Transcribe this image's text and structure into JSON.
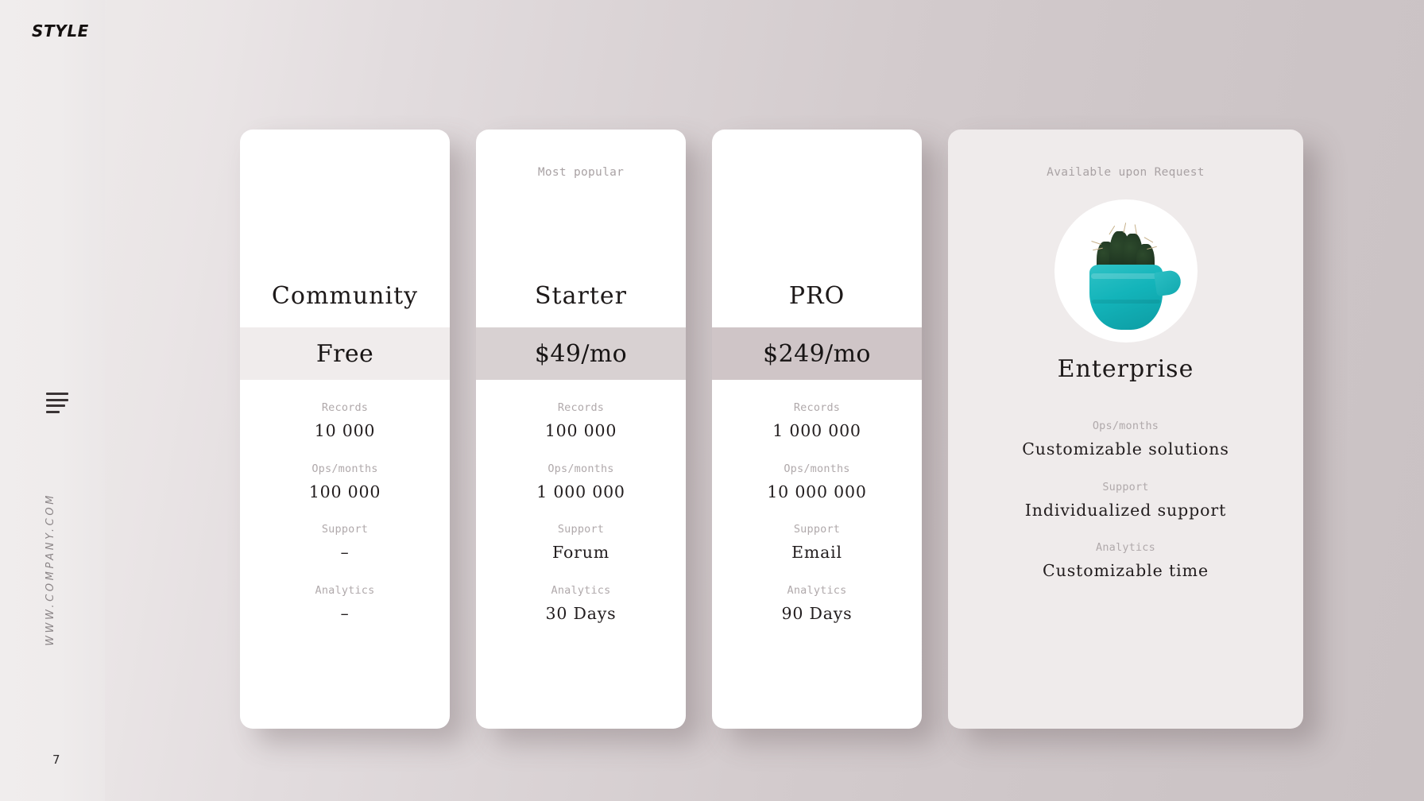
{
  "brand": {
    "logo": "STYLE",
    "url": "WWW.COMPANY.COM",
    "page_number": "7"
  },
  "icons": {
    "menu": "hamburger-menu-icon"
  },
  "colors": {
    "background_left": "#efecec",
    "background_right": "#cac2c4",
    "card_bg": "#ffffff",
    "enterprise_card_bg": "#efebeb",
    "price_band_1": "#f0ecec",
    "price_band_2": "#d8d1d2",
    "price_band_3": "#cfc5c7",
    "label_grey": "#b0a9ab",
    "accent_teal": "#13b4ba",
    "cactus_green": "#1d3320"
  },
  "feature_labels": {
    "records": "Records",
    "ops": "Ops/months",
    "support": "Support",
    "analytics": "Analytics"
  },
  "plans": [
    {
      "badge": "",
      "name": "Community",
      "price": "Free",
      "features": [
        {
          "label": "Records",
          "value": "10 000"
        },
        {
          "label": "Ops/months",
          "value": "100 000"
        },
        {
          "label": "Support",
          "value": "–"
        },
        {
          "label": "Analytics",
          "value": "–"
        }
      ]
    },
    {
      "badge": "Most popular",
      "name": "Starter",
      "price": "$49/mo",
      "features": [
        {
          "label": "Records",
          "value": "100 000"
        },
        {
          "label": "Ops/months",
          "value": "1 000 000"
        },
        {
          "label": "Support",
          "value": "Forum"
        },
        {
          "label": "Analytics",
          "value": "30 Days"
        }
      ]
    },
    {
      "badge": "",
      "name": "PRO",
      "price": "$249/mo",
      "features": [
        {
          "label": "Records",
          "value": "1 000 000"
        },
        {
          "label": "Ops/months",
          "value": "10 000 000"
        },
        {
          "label": "Support",
          "value": "Email"
        },
        {
          "label": "Analytics",
          "value": "90 Days"
        }
      ]
    }
  ],
  "enterprise": {
    "badge": "Available upon Request",
    "name": "Enterprise",
    "image": "cactus-in-teal-pot-photo",
    "features": [
      {
        "label": "Ops/months",
        "value": "Customizable solutions"
      },
      {
        "label": "Support",
        "value": "Individualized support"
      },
      {
        "label": "Analytics",
        "value": "Customizable time"
      }
    ]
  }
}
